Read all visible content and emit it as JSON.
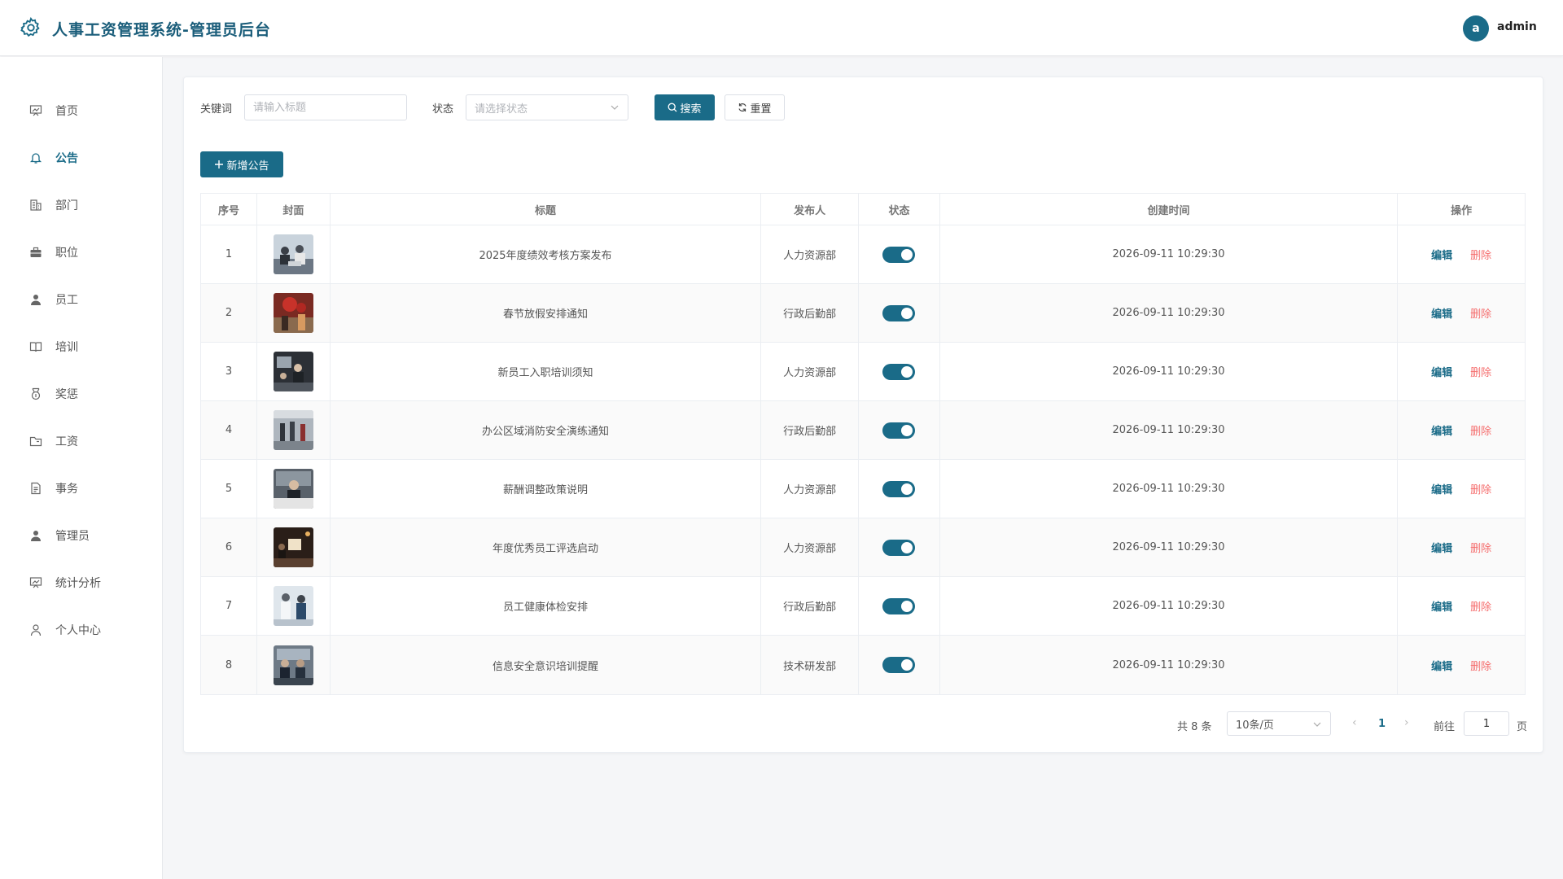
{
  "header": {
    "title": "人事工资管理系统-管理员后台",
    "avatar_letter": "a",
    "user_name": "admin"
  },
  "sidebar": {
    "items": [
      {
        "label": "首页",
        "icon": "chart-board-icon",
        "active": false
      },
      {
        "label": "公告",
        "icon": "bell-icon",
        "active": true
      },
      {
        "label": "部门",
        "icon": "building-icon",
        "active": false
      },
      {
        "label": "职位",
        "icon": "briefcase-icon",
        "active": false
      },
      {
        "label": "员工",
        "icon": "user-icon",
        "active": false
      },
      {
        "label": "培训",
        "icon": "book-icon",
        "active": false
      },
      {
        "label": "奖惩",
        "icon": "medal-icon",
        "active": false
      },
      {
        "label": "工资",
        "icon": "folder-icon",
        "active": false
      },
      {
        "label": "事务",
        "icon": "document-icon",
        "active": false
      },
      {
        "label": "管理员",
        "icon": "user-icon",
        "active": false
      },
      {
        "label": "统计分析",
        "icon": "chart-board-icon",
        "active": false
      },
      {
        "label": "个人中心",
        "icon": "user-outline-icon",
        "active": false
      }
    ]
  },
  "filters": {
    "keyword_label": "关键词",
    "keyword_placeholder": "请输入标题",
    "status_label": "状态",
    "status_placeholder": "请选择状态",
    "search_label": "搜索",
    "reset_label": "重置"
  },
  "toolbar": {
    "add_label": "新增公告"
  },
  "table": {
    "headers": [
      "序号",
      "封面",
      "标题",
      "发布人",
      "状态",
      "创建时间",
      "操作"
    ],
    "edit_label": "编辑",
    "delete_label": "删除",
    "rows": [
      {
        "index": "1",
        "title": "2025年度绩效考核方案发布",
        "publisher": "人力资源部",
        "status_on": true,
        "created": "2026-09-11 10:29:30"
      },
      {
        "index": "2",
        "title": "春节放假安排通知",
        "publisher": "行政后勤部",
        "status_on": true,
        "created": "2026-09-11 10:29:30"
      },
      {
        "index": "3",
        "title": "新员工入职培训须知",
        "publisher": "人力资源部",
        "status_on": true,
        "created": "2026-09-11 10:29:30"
      },
      {
        "index": "4",
        "title": "办公区域消防安全演练通知",
        "publisher": "行政后勤部",
        "status_on": true,
        "created": "2026-09-11 10:29:30"
      },
      {
        "index": "5",
        "title": "薪酬调整政策说明",
        "publisher": "人力资源部",
        "status_on": true,
        "created": "2026-09-11 10:29:30"
      },
      {
        "index": "6",
        "title": "年度优秀员工评选启动",
        "publisher": "人力资源部",
        "status_on": true,
        "created": "2026-09-11 10:29:30"
      },
      {
        "index": "7",
        "title": "员工健康体检安排",
        "publisher": "行政后勤部",
        "status_on": true,
        "created": "2026-09-11 10:29:30"
      },
      {
        "index": "8",
        "title": "信息安全意识培训提醒",
        "publisher": "技术研发部",
        "status_on": true,
        "created": "2026-09-11 10:29:30"
      }
    ]
  },
  "pagination": {
    "total_text": "共 8 条",
    "page_size": "10条/页",
    "current_page": "1",
    "goto_label": "前往",
    "goto_value": "1",
    "page_suffix": "页"
  }
}
